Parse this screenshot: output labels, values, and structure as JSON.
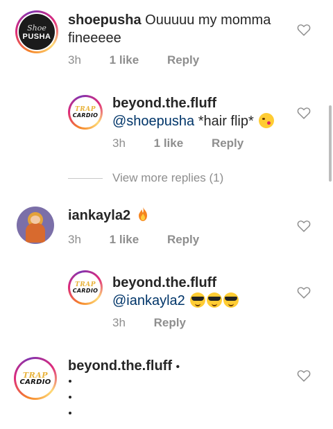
{
  "comments": [
    {
      "username": "shoepusha",
      "text": "Ouuuuu my momma fineeeee",
      "text_line1": "Ouuuuu my momma",
      "text_line2": "fineeeee",
      "time": "3h",
      "likes": "1 like",
      "reply": "Reply",
      "avatar_text": "PUSHA",
      "avatar_script": "Shoe"
    },
    {
      "username": "beyond.the.fluff",
      "mention": "@shoepusha",
      "text": "*hair flip*",
      "emoji": "kissing-face-with-heart",
      "time": "3h",
      "likes": "1 like",
      "reply": "Reply",
      "avatar_top": "TRAP",
      "avatar_bottom": "CARDIO"
    },
    {
      "username": "iankayla2",
      "emoji": "fire",
      "time": "3h",
      "likes": "1 like",
      "reply": "Reply"
    },
    {
      "username": "beyond.the.fluff",
      "mention": "@iankayla2",
      "emoji": "sunglasses-face x3",
      "time": "3h",
      "reply": "Reply",
      "avatar_top": "TRAP",
      "avatar_bottom": "CARDIO"
    },
    {
      "username": "beyond.the.fluff",
      "suffix": "•",
      "avatar_top": "TRAP",
      "avatar_bottom": "CARDIO"
    }
  ],
  "view_more": "View more replies (1)",
  "colors": {
    "text": "#262626",
    "meta": "#8e8e8e",
    "mention": "#003569"
  }
}
